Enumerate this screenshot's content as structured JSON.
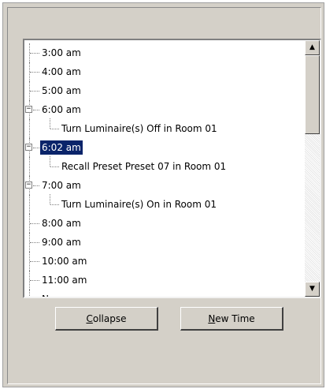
{
  "tree": {
    "items": [
      {
        "label": "3:00 am",
        "level": 0,
        "expander": ""
      },
      {
        "label": "4:00 am",
        "level": 0,
        "expander": ""
      },
      {
        "label": "5:00 am",
        "level": 0,
        "expander": ""
      },
      {
        "label": "6:00 am",
        "level": 0,
        "expander": "−"
      },
      {
        "label": "Turn Luminaire(s) Off in Room 01",
        "level": 1,
        "expander": ""
      },
      {
        "label": "6:02 am",
        "level": 0,
        "expander": "−",
        "selected": true
      },
      {
        "label": "Recall Preset Preset 07 in Room 01",
        "level": 1,
        "expander": ""
      },
      {
        "label": "7:00 am",
        "level": 0,
        "expander": "−"
      },
      {
        "label": "Turn Luminaire(s) On in Room 01",
        "level": 1,
        "expander": ""
      },
      {
        "label": "8:00 am",
        "level": 0,
        "expander": ""
      },
      {
        "label": "9:00 am",
        "level": 0,
        "expander": ""
      },
      {
        "label": "10:00 am",
        "level": 0,
        "expander": ""
      },
      {
        "label": "11:00 am",
        "level": 0,
        "expander": ""
      },
      {
        "label": "N...",
        "level": 0,
        "expander": ""
      }
    ]
  },
  "scrollbar": {
    "up_arrow": "▲",
    "down_arrow": "▼"
  },
  "buttons": {
    "collapse": {
      "mnemonic": "C",
      "rest": "ollapse"
    },
    "new_time": {
      "mnemonic": "N",
      "rest": "ew Time"
    }
  }
}
